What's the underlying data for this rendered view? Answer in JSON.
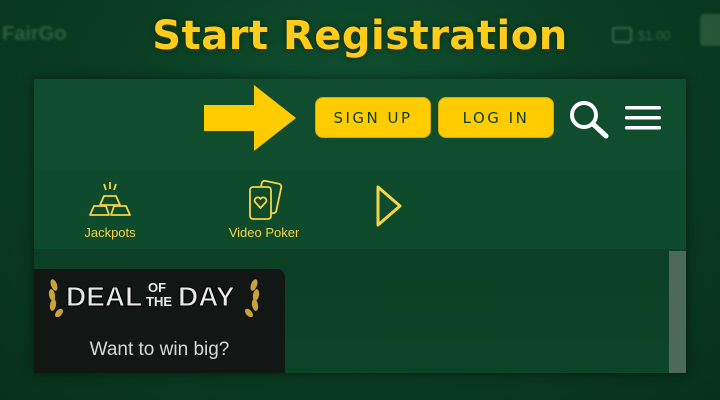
{
  "headline": "Start Registration",
  "header": {
    "signup_label": "SIGN UP",
    "login_label": "LOG IN",
    "icons": [
      "arrow-right-icon",
      "search-icon",
      "hamburger-menu-icon"
    ]
  },
  "categories": [
    {
      "label": "Jackpots",
      "icon": "gold-bars-icon"
    },
    {
      "label": "Video Poker",
      "icon": "playing-cards-icon"
    }
  ],
  "deal": {
    "badge_text": "DEAL OF THE DAY",
    "badge_word1": "DEAL",
    "badge_of": "OF",
    "badge_the": "THE",
    "badge_word2": "DAY",
    "tagline": "Want to win big?"
  },
  "colors": {
    "accent": "#ffcc00",
    "headline": "#ffcc1a",
    "panel": "#0e4a2c",
    "background": "#0b3f24",
    "button_text": "#0e3c22",
    "deal_card": "#121614"
  }
}
